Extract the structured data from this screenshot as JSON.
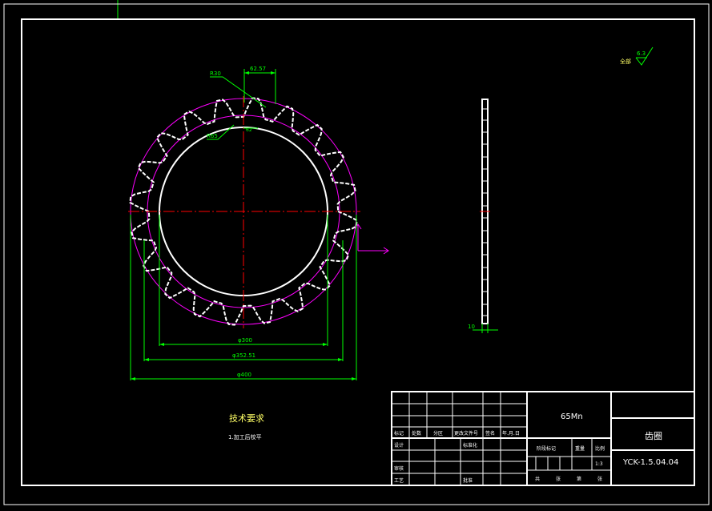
{
  "colors": {
    "background": "#000000",
    "frame": "#ffffff",
    "dimension": "#00ff00",
    "centerline": "#ff0000",
    "construction": "#ff00ff",
    "gear_outline": "#ffffff"
  },
  "gear_view": {
    "dim_top": "62.57",
    "radius_30": "R30",
    "radius_65": "R65",
    "small_label": "62",
    "dim_inner": "φ300",
    "dim_pitch": "φ352.51",
    "dim_outer": "φ400"
  },
  "side_view": {
    "thickness": "10"
  },
  "roughness": {
    "prefix": "全部",
    "value": "6.3"
  },
  "tech_requirements": {
    "title": "技术要求",
    "item1": "1.加工后校平"
  },
  "title_block": {
    "material": "65Mn",
    "part_name": "齿圈",
    "drawing_number": "YCK-1.5.04.04",
    "row_headers": [
      "标记",
      "处数",
      "分区",
      "更改文件号",
      "签名",
      "年.月.日"
    ],
    "design": "设计",
    "standardize": "标准化",
    "check": "审核",
    "process": "工艺",
    "approve": "批准",
    "stage_mark": "阶段标记",
    "weight": "重量",
    "scale_label": "比例",
    "scale_value": "1:3",
    "sheets": [
      "共",
      "张",
      "第",
      "张"
    ]
  }
}
